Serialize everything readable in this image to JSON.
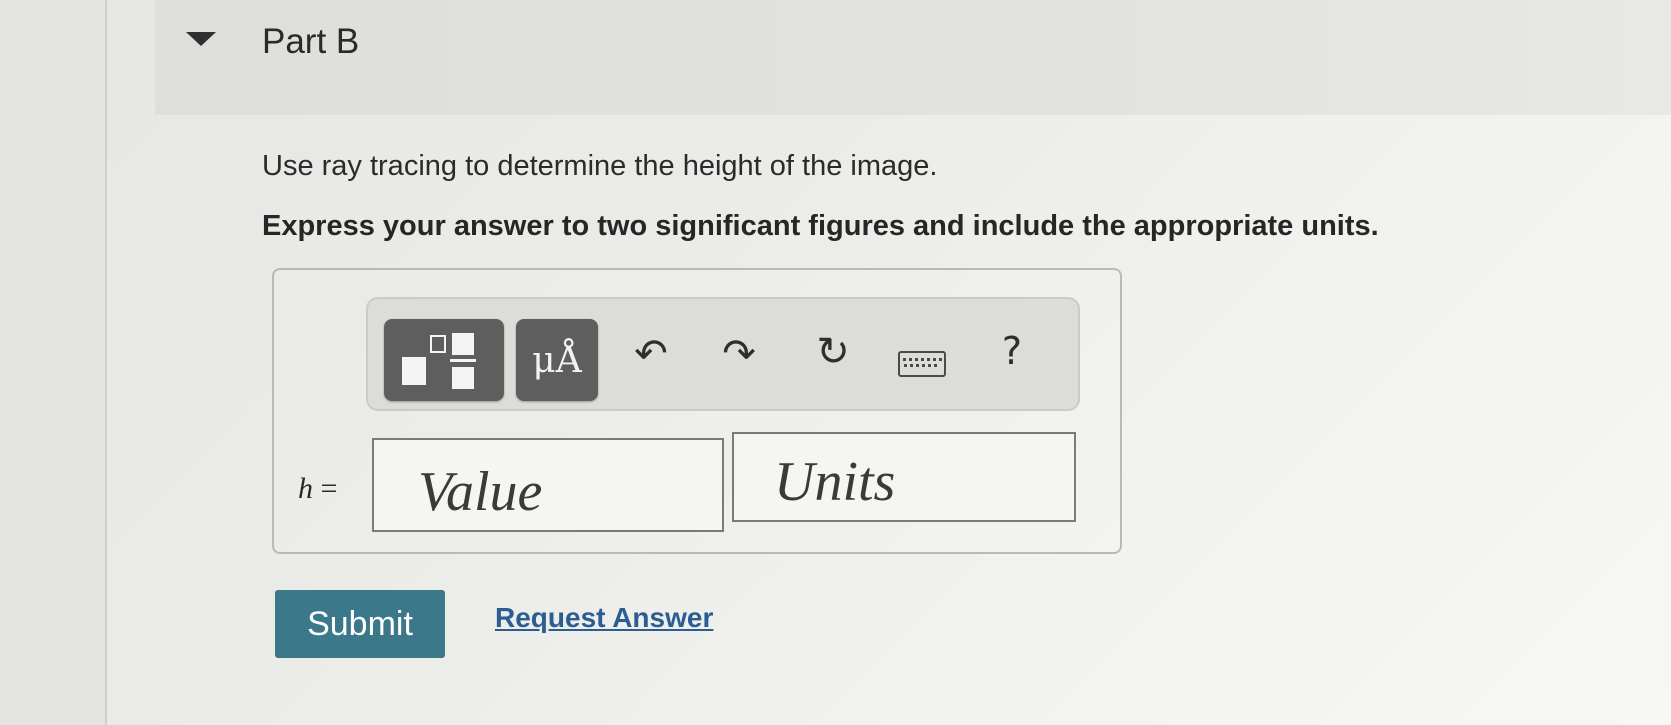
{
  "part": {
    "title": "Part B"
  },
  "question": {
    "prompt": "Use ray tracing to determine the height of the image.",
    "instruction": "Express your answer to two significant figures and include the appropriate units."
  },
  "toolbar": {
    "template_icon": "fraction-template-icon",
    "units_label": "μÅ",
    "undo_icon": "undo-icon",
    "redo_icon": "redo-icon",
    "reset_icon": "reset-icon",
    "keyboard_icon": "keyboard-icon",
    "help_label": "?"
  },
  "answer": {
    "variable": "h",
    "equals": "=",
    "value_placeholder": "Value",
    "units_placeholder": "Units"
  },
  "actions": {
    "submit_label": "Submit",
    "request_label": "Request Answer"
  },
  "colors": {
    "submit_bg": "#3b7889",
    "link": "#2c5d92",
    "toolbar_button": "#5e5e5e"
  }
}
